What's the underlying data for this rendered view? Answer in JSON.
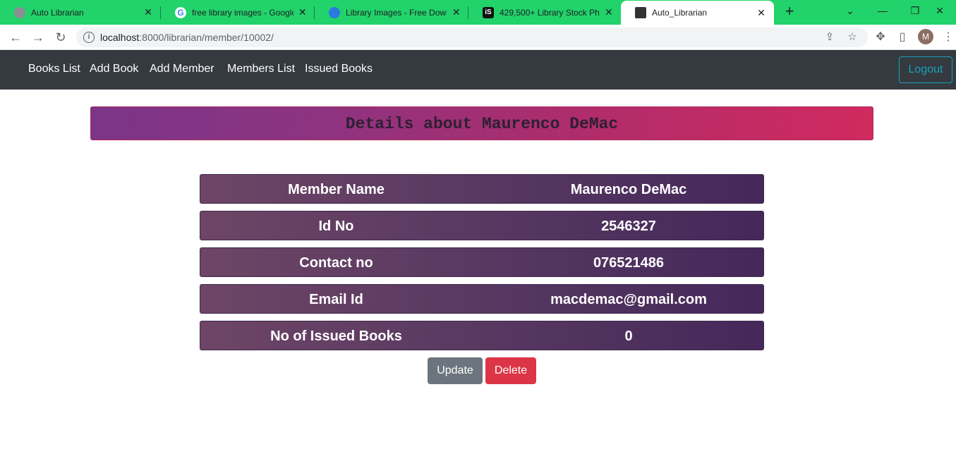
{
  "browser": {
    "tabs": [
      {
        "title": "Auto Librarian",
        "icon": "globe-icon",
        "active": false
      },
      {
        "title": "free library images - Google S",
        "icon": "google-icon",
        "active": false
      },
      {
        "title": "Library Images - Free Downlo",
        "icon": "pixabay-icon",
        "active": false
      },
      {
        "title": "429,500+ Library Stock Photo",
        "icon": "istock-icon",
        "active": false
      },
      {
        "title": "Auto_Librarian",
        "icon": "library-icon",
        "active": true
      }
    ],
    "new_tab": "+",
    "url_host": "localhost",
    "url_rest": ":8000/librarian/member/10002/",
    "profile_initial": "M"
  },
  "nav": {
    "links": [
      "Books List",
      "Add Book",
      "Add Member",
      "Members List",
      "Issued Books"
    ],
    "logout": "Logout"
  },
  "page": {
    "title": "Details about Maurenco DeMac",
    "details": [
      {
        "label": "Member Name",
        "value": "Maurenco DeMac"
      },
      {
        "label": "Id No",
        "value": "2546327"
      },
      {
        "label": "Contact no",
        "value": "076521486"
      },
      {
        "label": "Email Id",
        "value": "macdemac@gmail.com"
      },
      {
        "label": "No of Issued Books",
        "value": "0"
      }
    ],
    "update_label": "Update",
    "delete_label": "Delete"
  },
  "colors": {
    "tabbar": "#21d36a",
    "navbar": "#343a40",
    "logout_accent": "#17a2b8",
    "update_button": "#6c757d",
    "delete_button": "#dc3545"
  }
}
